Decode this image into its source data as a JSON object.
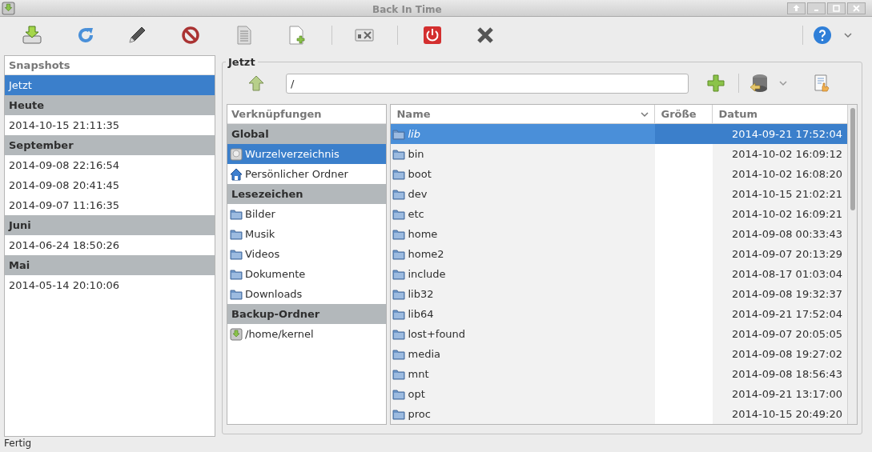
{
  "window": {
    "title": "Back In Time"
  },
  "snapshots": {
    "header": "Snapshots",
    "items": [
      {
        "kind": "item",
        "label": "Jetzt",
        "selected": true
      },
      {
        "kind": "group",
        "label": "Heute"
      },
      {
        "kind": "item",
        "label": "2014-10-15 21:11:35",
        "selected": false
      },
      {
        "kind": "group",
        "label": "September"
      },
      {
        "kind": "item",
        "label": "2014-09-08 22:16:54",
        "selected": false
      },
      {
        "kind": "item",
        "label": "2014-09-08 20:41:45",
        "selected": false
      },
      {
        "kind": "item",
        "label": "2014-09-07 11:16:35",
        "selected": false
      },
      {
        "kind": "group",
        "label": "Juni"
      },
      {
        "kind": "item",
        "label": "2014-06-24 18:50:26",
        "selected": false
      },
      {
        "kind": "group",
        "label": "Mai"
      },
      {
        "kind": "item",
        "label": "2014-05-14 20:10:06",
        "selected": false
      }
    ]
  },
  "browser": {
    "title": "Jetzt",
    "path": "/",
    "shortcuts": {
      "header": "Verknüpfungen",
      "items": [
        {
          "kind": "group",
          "label": "Global"
        },
        {
          "kind": "drive",
          "label": "Wurzelverzeichnis",
          "selected": true
        },
        {
          "kind": "home",
          "label": "Persönlicher Ordner",
          "selected": false
        },
        {
          "kind": "group",
          "label": "Lesezeichen"
        },
        {
          "kind": "folder",
          "label": "Bilder",
          "selected": false
        },
        {
          "kind": "folder",
          "label": "Musik",
          "selected": false
        },
        {
          "kind": "folder",
          "label": "Videos",
          "selected": false
        },
        {
          "kind": "folder",
          "label": "Dokumente",
          "selected": false
        },
        {
          "kind": "folder",
          "label": "Downloads",
          "selected": false
        },
        {
          "kind": "group",
          "label": "Backup-Ordner"
        },
        {
          "kind": "backup",
          "label": "/home/kernel",
          "selected": false
        }
      ]
    },
    "files": {
      "columns": [
        {
          "label": "Name",
          "sorted": true
        },
        {
          "label": "Größe",
          "sorted": false
        },
        {
          "label": "Datum",
          "sorted": false
        }
      ],
      "rows": [
        {
          "kind": "symlink",
          "name": "lib",
          "date": "2014-09-21 17:52:04",
          "selected": true
        },
        {
          "kind": "folder",
          "name": "bin",
          "date": "2014-10-02 16:09:12",
          "selected": false
        },
        {
          "kind": "folder",
          "name": "boot",
          "date": "2014-10-02 16:08:20",
          "selected": false
        },
        {
          "kind": "folder",
          "name": "dev",
          "date": "2014-10-15 21:02:21",
          "selected": false
        },
        {
          "kind": "folder",
          "name": "etc",
          "date": "2014-10-02 16:09:21",
          "selected": false
        },
        {
          "kind": "folder",
          "name": "home",
          "date": "2014-09-08 00:33:43",
          "selected": false
        },
        {
          "kind": "folder",
          "name": "home2",
          "date": "2014-09-07 20:13:29",
          "selected": false
        },
        {
          "kind": "folder",
          "name": "include",
          "date": "2014-08-17 01:03:04",
          "selected": false
        },
        {
          "kind": "folder",
          "name": "lib32",
          "date": "2014-09-08 19:32:37",
          "selected": false
        },
        {
          "kind": "folder",
          "name": "lib64",
          "date": "2014-09-21 17:52:04",
          "selected": false
        },
        {
          "kind": "folder",
          "name": "lost+found",
          "date": "2014-09-07 20:05:05",
          "selected": false
        },
        {
          "kind": "folder",
          "name": "media",
          "date": "2014-09-08 19:27:02",
          "selected": false
        },
        {
          "kind": "folder",
          "name": "mnt",
          "date": "2014-09-08 18:56:43",
          "selected": false
        },
        {
          "kind": "folder",
          "name": "opt",
          "date": "2014-09-21 13:17:00",
          "selected": false
        },
        {
          "kind": "folder",
          "name": "proc",
          "date": "2014-10-15 20:49:20",
          "selected": false
        }
      ]
    }
  },
  "status_bar": "Fertig"
}
